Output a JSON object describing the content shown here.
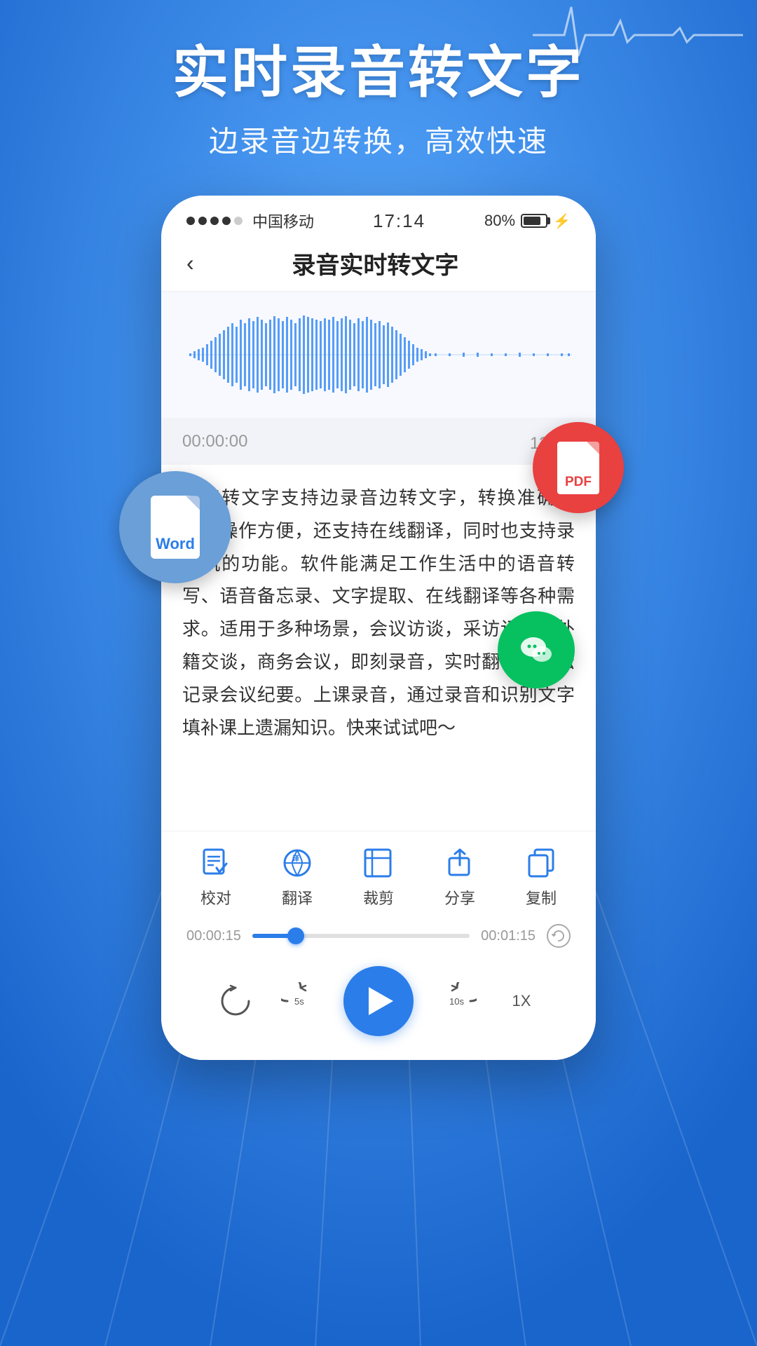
{
  "header": {
    "main_title": "实时录音转文字",
    "subtitle": "边录音边转换，高效快速"
  },
  "status_bar": {
    "dots": [
      "filled",
      "filled",
      "filled",
      "filled",
      "empty"
    ],
    "carrier": "中国移动",
    "time": "17:14",
    "battery": "80%"
  },
  "phone": {
    "nav_title": "录音实时转文字",
    "back_label": "‹",
    "time_display": "00:00:00",
    "char_count": "138字",
    "transcript": "录音转文字支持边录音边转文字，转换准确迅捷，操作方便，还支持在线翻译，同时也支持录音机的功能。软件能满足工作生活中的语音转写、语音备忘录、文字提取、在线翻译等各种需求。适用于多种场景，会议访谈，采访记录、外籍交谈，商务会议，即刻录音，实时翻译，轻松记录会议纪要。上课录音，通过录音和识别文字填补课上遗漏知识。快来试试吧～",
    "toolbar_items": [
      {
        "label": "校对",
        "icon": "edit-check-icon"
      },
      {
        "label": "翻译",
        "icon": "translate-icon"
      },
      {
        "label": "裁剪",
        "icon": "scissors-icon"
      },
      {
        "label": "分享",
        "icon": "share-icon"
      },
      {
        "label": "复制",
        "icon": "copy-icon"
      }
    ],
    "progress": {
      "time_left": "00:00:15",
      "time_right": "00:01:15",
      "fill_percent": 20
    },
    "controls": {
      "rewind_label": "↺",
      "skip_back": "5s",
      "play": "▶",
      "skip_forward": "10s",
      "speed": "1X"
    }
  },
  "badges": {
    "word": "Word",
    "pdf": "PDF",
    "wechat_icon": "wechat"
  }
}
